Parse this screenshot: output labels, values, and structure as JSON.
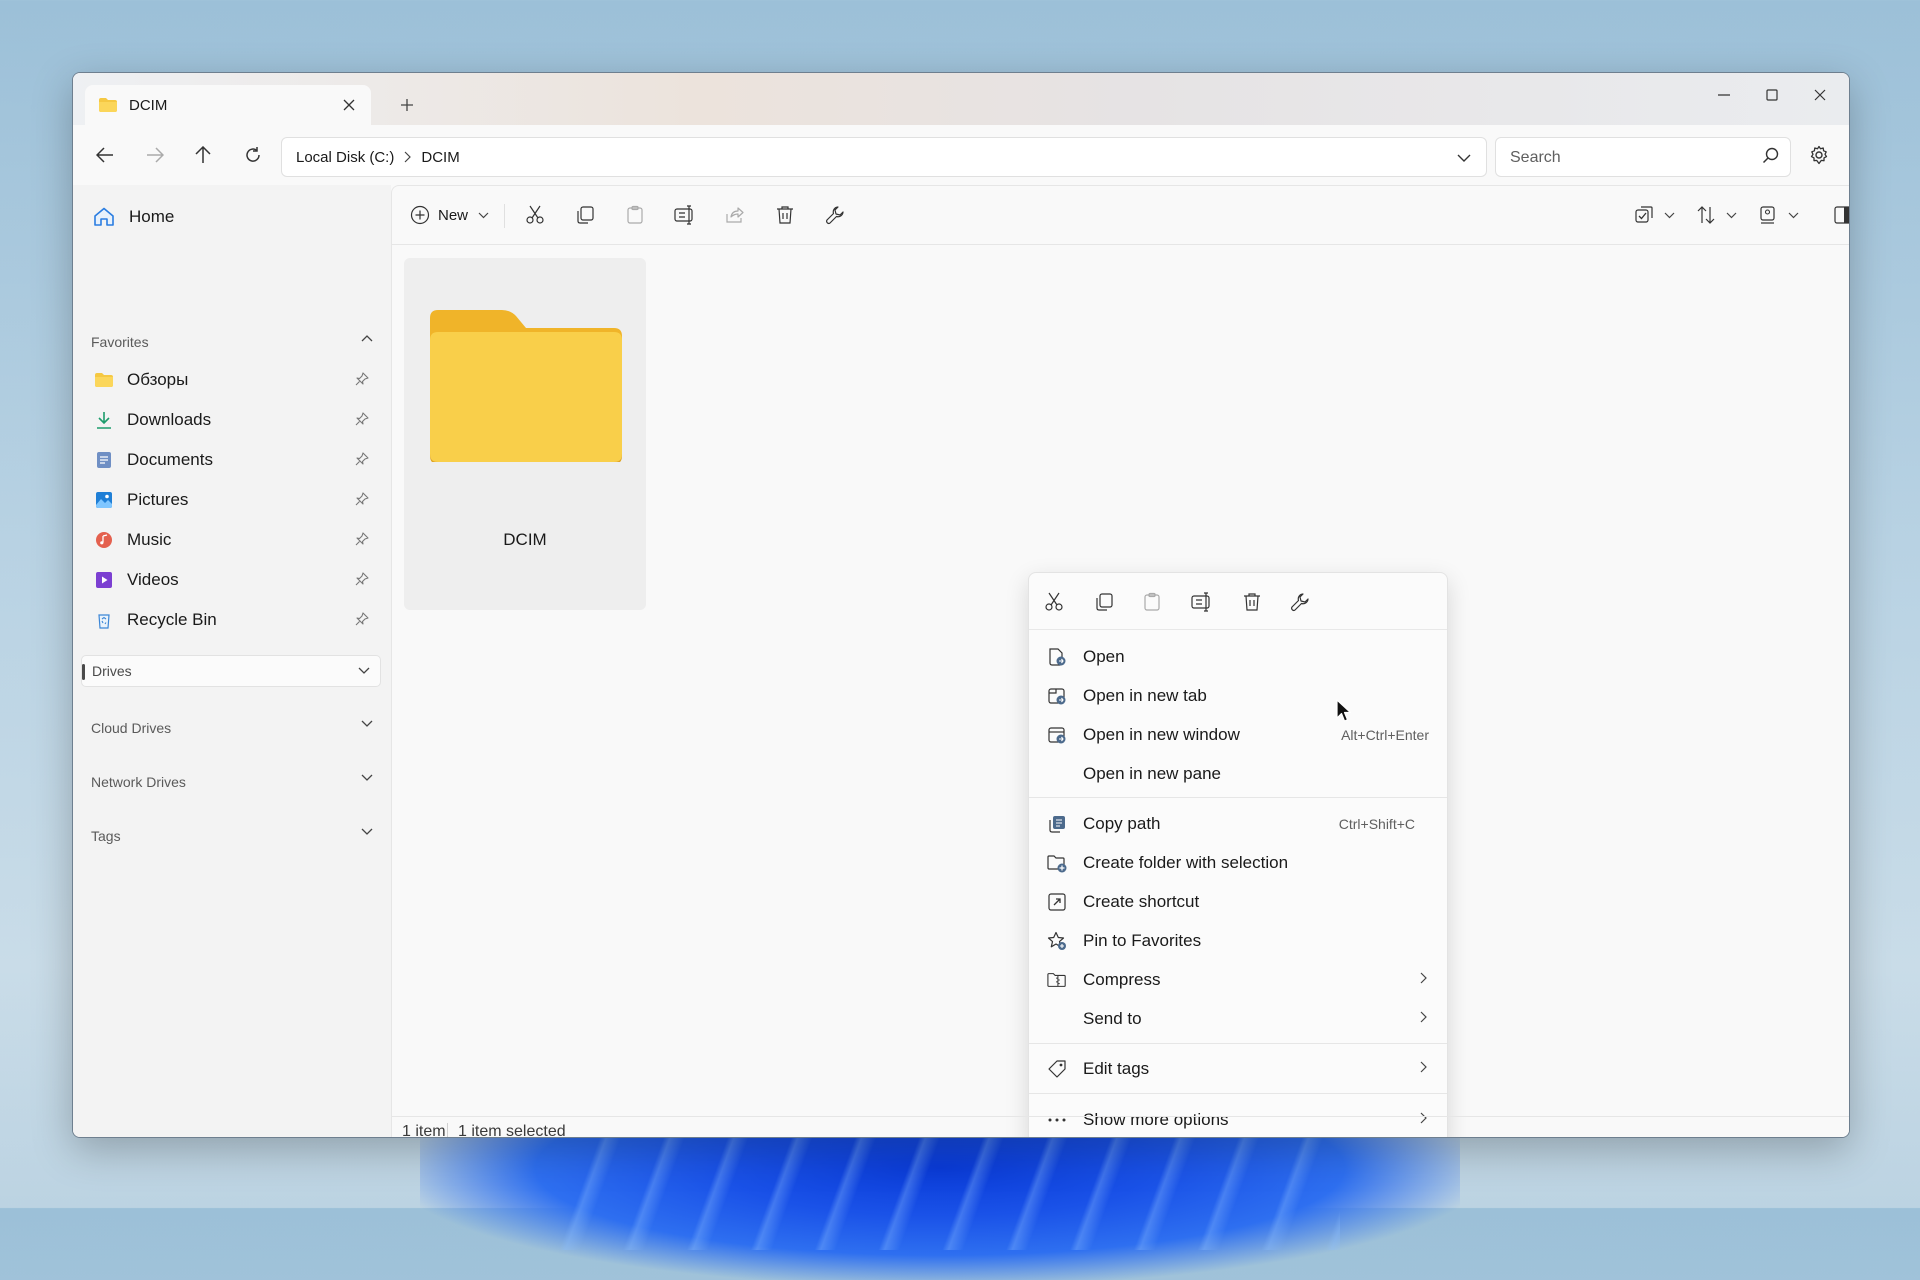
{
  "window": {
    "tab_title": "DCIM",
    "new_tab_label": "+"
  },
  "navbar": {
    "breadcrumbs": [
      "Local Disk (C:)",
      "DCIM"
    ],
    "search_placeholder": "Search"
  },
  "sidebar": {
    "home_label": "Home",
    "favorites_label": "Favorites",
    "favorites": [
      {
        "label": "Обзоры",
        "icon": "folder-icon"
      },
      {
        "label": "Downloads",
        "icon": "download-icon"
      },
      {
        "label": "Documents",
        "icon": "documents-icon"
      },
      {
        "label": "Pictures",
        "icon": "pictures-icon"
      },
      {
        "label": "Music",
        "icon": "music-icon"
      },
      {
        "label": "Videos",
        "icon": "videos-icon"
      },
      {
        "label": "Recycle Bin",
        "icon": "recycle-bin-icon"
      }
    ],
    "sections": [
      "Drives",
      "Cloud Drives",
      "Network Drives",
      "Tags"
    ]
  },
  "commandbar": {
    "new_label": "New"
  },
  "content": {
    "items": [
      {
        "name": "DCIM",
        "type": "folder"
      }
    ]
  },
  "context_menu": {
    "items": [
      {
        "label": "Open",
        "shortcut": "",
        "submenu": false,
        "icon": "open-icon"
      },
      {
        "label": "Open in new tab",
        "shortcut": "",
        "submenu": false,
        "icon": "open-new-tab-icon"
      },
      {
        "label": "Open in new window",
        "shortcut": "Alt+Ctrl+Enter",
        "submenu": false,
        "icon": "open-new-window-icon"
      },
      {
        "label": "Open in new pane",
        "shortcut": "",
        "submenu": false,
        "icon": ""
      },
      {
        "label": "Copy path",
        "shortcut": "Ctrl+Shift+C",
        "submenu": false,
        "icon": "copy-path-icon"
      },
      {
        "label": "Create folder with selection",
        "shortcut": "",
        "submenu": false,
        "icon": "create-folder-icon"
      },
      {
        "label": "Create shortcut",
        "shortcut": "",
        "submenu": false,
        "icon": "shortcut-icon"
      },
      {
        "label": "Pin to Favorites",
        "shortcut": "",
        "submenu": false,
        "icon": "pin-favorites-icon"
      },
      {
        "label": "Compress",
        "shortcut": "",
        "submenu": true,
        "icon": "compress-icon"
      },
      {
        "label": "Send to",
        "shortcut": "",
        "submenu": true,
        "icon": ""
      },
      {
        "label": "Edit tags",
        "shortcut": "",
        "submenu": true,
        "icon": "tag-icon"
      },
      {
        "label": "Show more options",
        "shortcut": "",
        "submenu": true,
        "icon": "more-icon"
      }
    ]
  },
  "status": {
    "item_count": "1 item",
    "selection": "1 item selected"
  },
  "colors": {
    "folder_yellow": "#f5c842",
    "accent": "#0067c0"
  }
}
